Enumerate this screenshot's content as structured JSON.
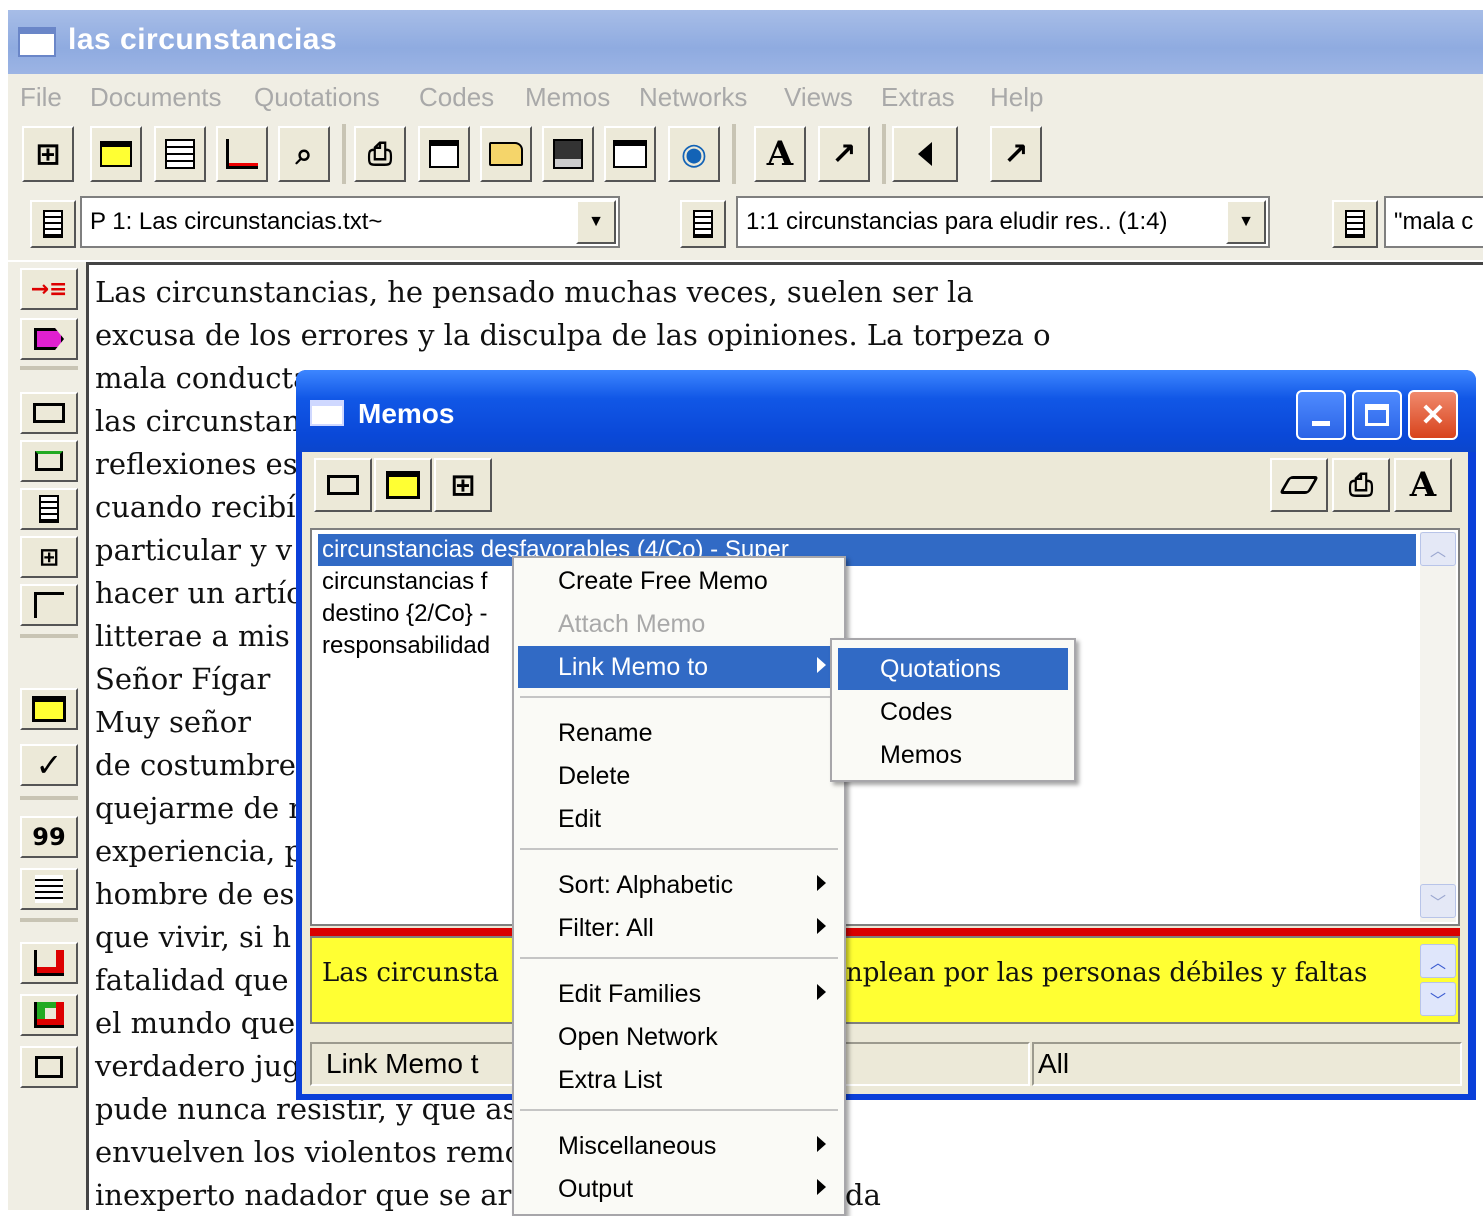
{
  "main_window": {
    "title": "las circunstancias",
    "menu": [
      "File",
      "Documents",
      "Quotations",
      "Codes",
      "Memos",
      "Networks",
      "Views",
      "Extras",
      "Help"
    ],
    "toolbar_glyphs": {
      "network": "⊞",
      "memo": "▭",
      "text_a": "A",
      "hammer": "↗",
      "print": "⎙",
      "binoculars": "⌕",
      "globe": "◉"
    }
  },
  "selectors": {
    "document": "P 1: Las circunstancias.txt~",
    "quotation": "1:1 circunstancias para eludir res.. (1:4)",
    "code": "\"mala c"
  },
  "left_toolbar": {
    "count_label": "99"
  },
  "document_lines": [
    "   Las circunstancias, he pensado muchas veces, suelen ser la",
    "excusa de los errores y la disculpa de las opiniones. La torpeza o",
    "mala conducta",
    "las circunstan",
    "reflexiones es",
    "cuando recibí",
    "particular y v",
    "hacer un artíc",
    "litterae a mis",
    "   Señor Fígar",
    "   Muy señor",
    "de costumbre",
    "quejarme de r",
    "experiencia, p",
    "hombre de es",
    "que vivir, si h",
    "fatalidad que",
    "el mundo que",
    "verdadero jug",
    "pude nunca resistir, y que así",
    "envuelven los violentos remo",
    "inexperto nadador que se ar"
  ],
  "document_tail_text": "da",
  "memos_window": {
    "title": "Memos",
    "list": [
      {
        "text": "circunstancias desfavorables (4/Co) - Super",
        "selected": true
      },
      {
        "text": "circunstancias f",
        "selected": false
      },
      {
        "text": "destino {2/Co} -",
        "selected": false
      },
      {
        "text": "responsabilidad",
        "selected": false
      }
    ],
    "preview_left": "Las circunsta",
    "preview_right": "nplean por las personas débiles y faltas",
    "status_left": "Link Memo t",
    "status_right": "All"
  },
  "context_menu": {
    "items": [
      {
        "label": "Create Free Memo",
        "state": "normal",
        "submenu": false
      },
      {
        "label": "Attach Memo",
        "state": "disabled",
        "submenu": false
      },
      {
        "label": "Link Memo to",
        "state": "active",
        "submenu": true
      },
      {
        "label": "Rename",
        "state": "normal",
        "submenu": false
      },
      {
        "label": "Delete",
        "state": "normal",
        "submenu": false
      },
      {
        "label": "Edit",
        "state": "normal",
        "submenu": false
      },
      {
        "label": "Sort: Alphabetic",
        "state": "normal",
        "submenu": true
      },
      {
        "label": "Filter: All",
        "state": "normal",
        "submenu": true
      },
      {
        "label": "Edit Families",
        "state": "normal",
        "submenu": true
      },
      {
        "label": "Open Network",
        "state": "normal",
        "submenu": false
      },
      {
        "label": "Extra List",
        "state": "normal",
        "submenu": false
      },
      {
        "label": "Miscellaneous",
        "state": "normal",
        "submenu": true
      },
      {
        "label": "Output",
        "state": "normal",
        "submenu": true
      }
    ]
  },
  "submenu": {
    "items": [
      {
        "label": "Quotations",
        "state": "active"
      },
      {
        "label": "Codes",
        "state": "normal"
      },
      {
        "label": "Memos",
        "state": "normal"
      }
    ]
  },
  "colors": {
    "selection_blue": "#316ac5",
    "xp_title_blue": "#0a48d8",
    "preview_yellow": "#ffff33",
    "splitter_red": "#d90000"
  }
}
